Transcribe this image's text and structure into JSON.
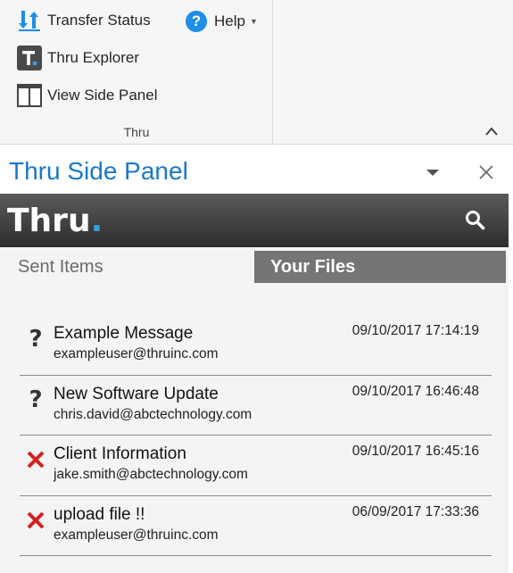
{
  "ribbon": {
    "transfer_status_label": "Transfer Status",
    "thru_explorer_label": "Thru Explorer",
    "view_side_panel_label": "View Side Panel",
    "help_label": "Help",
    "group_label": "Thru"
  },
  "panel": {
    "title": "Thru Side Panel",
    "logo_text": "Thru",
    "logo_dot": "."
  },
  "tabs": {
    "sent_items": "Sent Items",
    "your_files": "Your Files",
    "active": "Your Files"
  },
  "items": [
    {
      "status": "pending",
      "status_icon": "question-icon",
      "subject": "Example Message",
      "sender": "exampleuser@thruinc.com",
      "date": "09/10/2017 17:14:19"
    },
    {
      "status": "pending",
      "status_icon": "question-icon",
      "subject": "New Software Update",
      "sender": "chris.david@abctechnology.com",
      "date": "09/10/2017 16:46:48"
    },
    {
      "status": "failed",
      "status_icon": "red-x-icon",
      "subject": "Client Information",
      "sender": "jake.smith@abctechnology.com",
      "date": "09/10/2017 16:45:16"
    },
    {
      "status": "failed",
      "status_icon": "red-x-icon",
      "subject": "upload file !!",
      "sender": "exampleuser@thruinc.com",
      "date": "06/09/2017 17:33:36"
    }
  ],
  "colors": {
    "accent_blue": "#1a78c8",
    "error_red": "#d42020",
    "tab_active_bg": "#757575"
  }
}
